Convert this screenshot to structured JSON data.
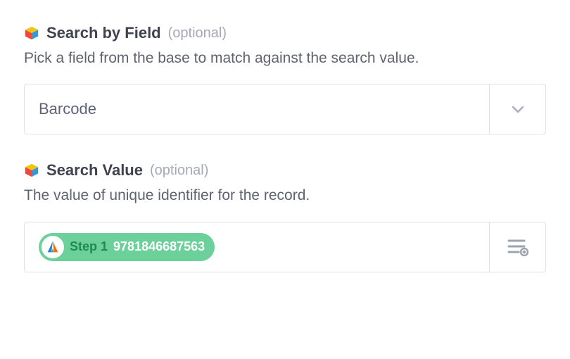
{
  "fields": {
    "searchByField": {
      "title": "Search by Field",
      "optional": "(optional)",
      "description": "Pick a field from the base to match against the search value.",
      "selected": "Barcode"
    },
    "searchValue": {
      "title": "Search Value",
      "optional": "(optional)",
      "description": "The value of unique identifier for the record.",
      "chip": {
        "step_label": "Step 1",
        "value": "9781846687563"
      }
    }
  }
}
